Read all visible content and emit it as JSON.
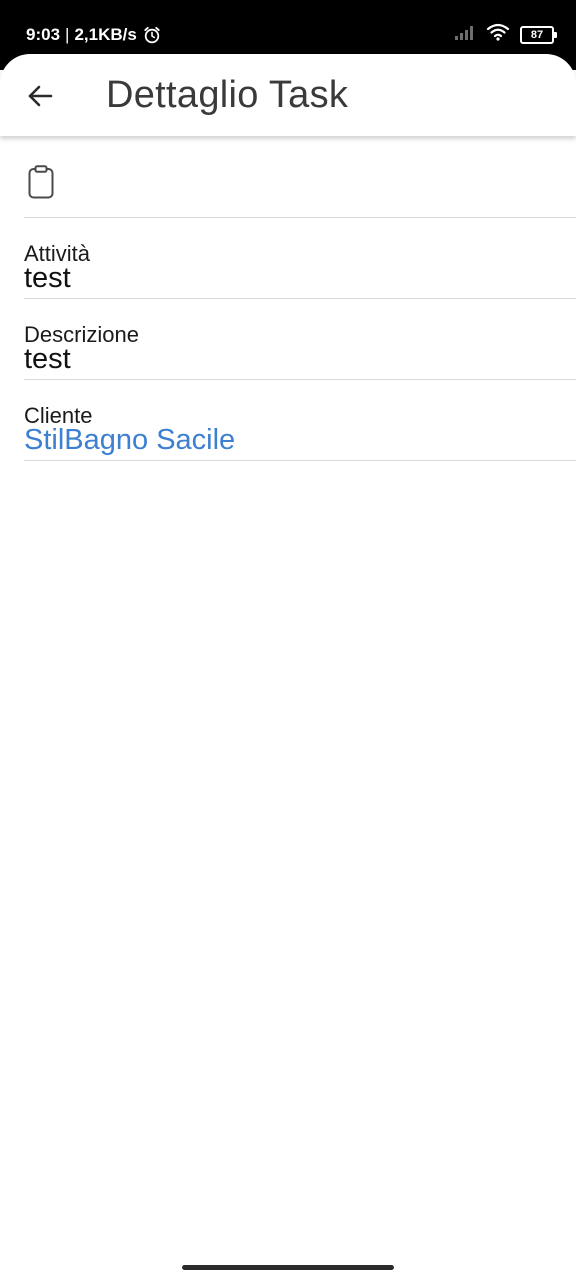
{
  "status_bar": {
    "time": "9:03",
    "separator": "|",
    "network_speed": "2,1KB/s",
    "battery_level": "87",
    "icons": [
      "alarm-icon",
      "signal-icon",
      "wifi-icon",
      "battery-icon"
    ]
  },
  "app_bar": {
    "back_icon": "arrow-left-icon",
    "title": "Dettaglio Task"
  },
  "header_icon": "clipboard-icon",
  "fields": {
    "activity": {
      "label": "Attività",
      "value": "test"
    },
    "description": {
      "label": "Descrizione",
      "value": "test"
    },
    "client": {
      "label": "Cliente",
      "value": "StilBagno Sacile",
      "link_color": "#3d7fd1"
    }
  }
}
